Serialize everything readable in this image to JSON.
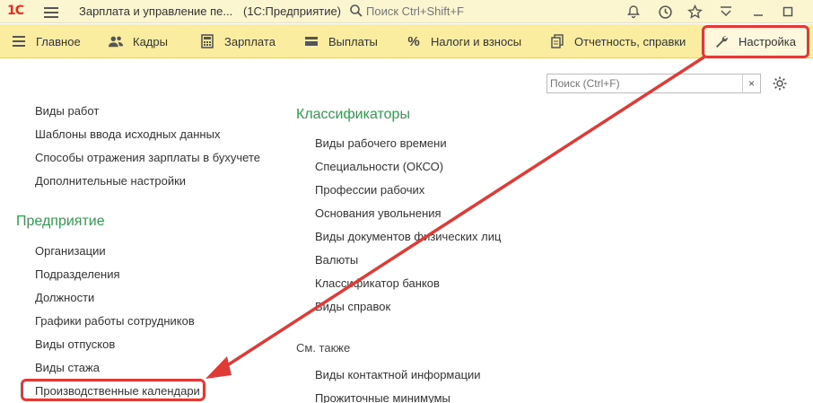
{
  "app": {
    "logo": "1С",
    "title": "Зарплата и управление пе...",
    "subtitle": "(1С:Предприятие)",
    "search_placeholder": "Поиск Ctrl+Shift+F"
  },
  "sections": [
    {
      "label": "Главное",
      "icon": "lines-icon"
    },
    {
      "label": "Кадры",
      "icon": "people-icon"
    },
    {
      "label": "Зарплата",
      "icon": "calculator-icon"
    },
    {
      "label": "Выплаты",
      "icon": "wallet-icon"
    },
    {
      "label": "Налоги и взносы",
      "icon": "percent-icon"
    },
    {
      "label": "Отчетность, справки",
      "icon": "documents-icon"
    },
    {
      "label": "Настройка",
      "icon": "wrench-icon"
    }
  ],
  "panel": {
    "search_placeholder": "Поиск (Ctrl+F)",
    "clear": "×"
  },
  "left_column": {
    "top_links": [
      "Виды работ",
      "Шаблоны ввода исходных данных",
      "Способы отражения зарплаты в бухучете",
      "Дополнительные настройки"
    ],
    "group_title": "Предприятие",
    "group_links": [
      "Организации",
      "Подразделения",
      "Должности",
      "Графики работы сотрудников",
      "Виды отпусков",
      "Виды стажа",
      "Производственные календари"
    ]
  },
  "right_column": {
    "group_title": "Классификаторы",
    "group_links": [
      "Виды рабочего времени",
      "Специальности (ОКСО)",
      "Профессии рабочих",
      "Основания увольнения",
      "Виды документов физических лиц",
      "Валюты",
      "Классификатор банков",
      "Виды справок"
    ],
    "see_also_title": "См. также",
    "see_also_links": [
      "Виды контактной информации",
      "Прожиточные минимумы"
    ]
  },
  "colors": {
    "accent_green": "#2d9e4c",
    "highlight_red": "#e03a36",
    "section_bar": "#fbeda0",
    "title_bar": "#fbf6d0"
  }
}
